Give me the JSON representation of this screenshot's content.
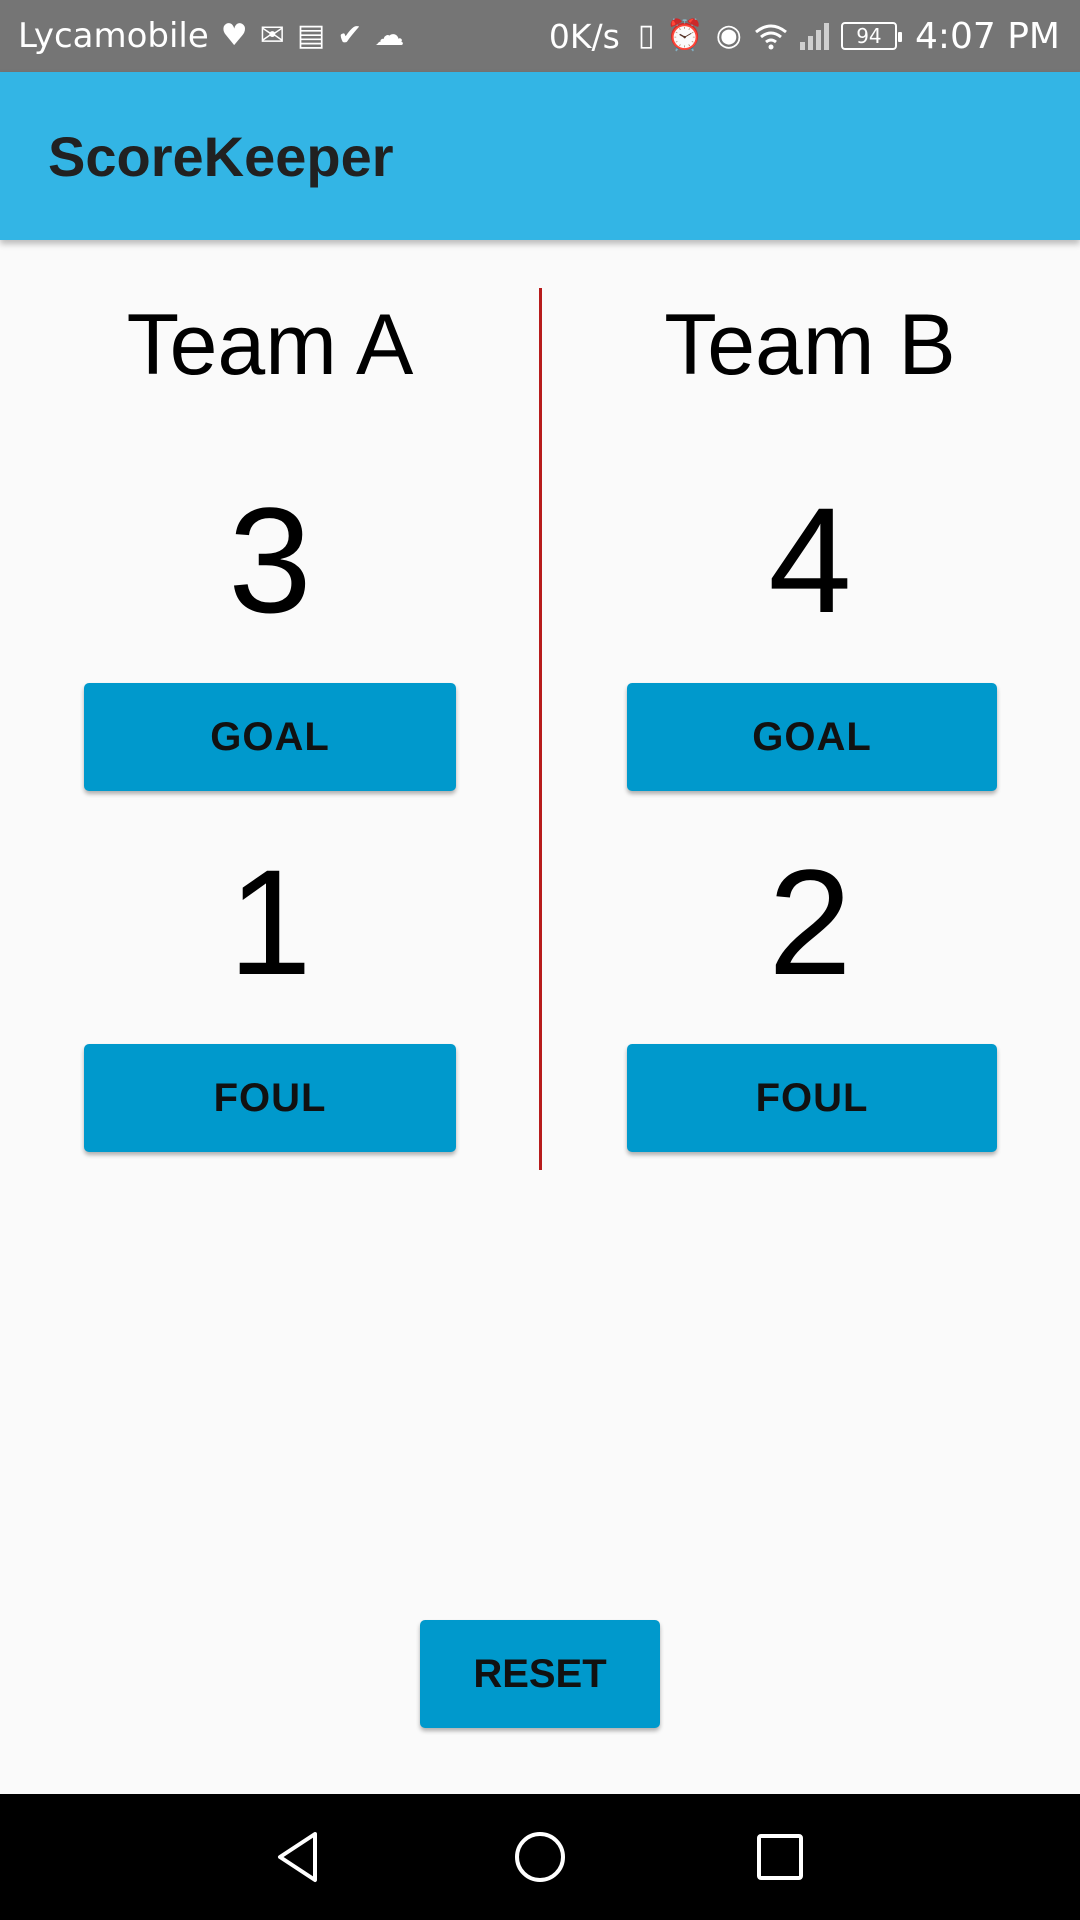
{
  "status_bar": {
    "carrier": "Lycamobile",
    "speed": "0K/s",
    "battery": "94",
    "time": "4:07 PM"
  },
  "app": {
    "title": "ScoreKeeper"
  },
  "team_a": {
    "name": "Team A",
    "score": "3",
    "goal_label": "GOAL",
    "fouls": "1",
    "foul_label": "FOUL"
  },
  "team_b": {
    "name": "Team B",
    "score": "4",
    "goal_label": "GOAL",
    "fouls": "2",
    "foul_label": "FOUL"
  },
  "reset_label": "RESET",
  "colors": {
    "status_bar": "#757575",
    "app_bar": "#33b5e5",
    "button": "#0099cc",
    "divider": "#b71c1c",
    "background": "#fafafa"
  }
}
